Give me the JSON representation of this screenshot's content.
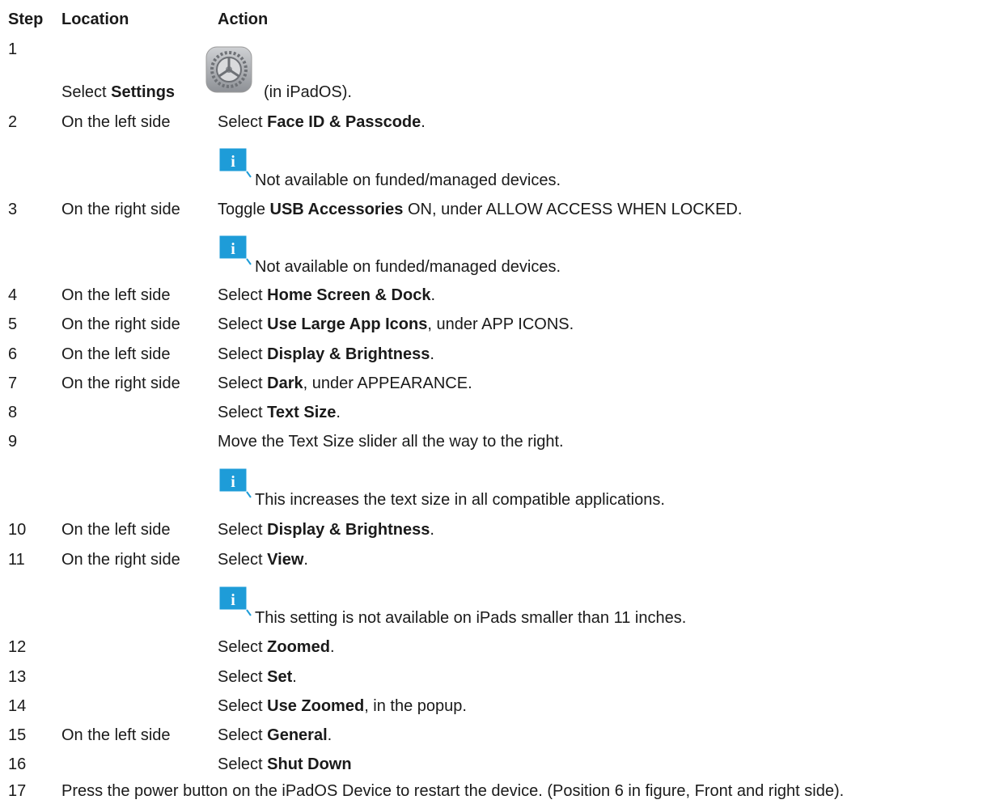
{
  "header": {
    "step": "Step",
    "location": "Location",
    "action": "Action"
  },
  "row1": {
    "step": "1",
    "prefix": "Select ",
    "bold": "Settings",
    "suffix": " (in iPadOS).",
    "icon": "settings-gear-icon"
  },
  "rows": [
    {
      "step": "2",
      "location": "On the left side",
      "pre": "Select ",
      "bold": "Face ID & Passcode",
      "post": "."
    },
    {
      "step": "3",
      "location": "On the right side",
      "pre": "Toggle ",
      "bold": "USB Accessories",
      "post": " ON, under ALLOW ACCESS WHEN LOCKED."
    },
    {
      "step": "4",
      "location": "On the left side",
      "pre": "Select ",
      "bold": "Home Screen & Dock",
      "post": "."
    },
    {
      "step": "5",
      "location": "On the right side",
      "pre": "Select ",
      "bold": "Use Large App Icons",
      "post": ", under APP ICONS."
    },
    {
      "step": "6",
      "location": "On the left side",
      "pre": "Select ",
      "bold": "Display & Brightness",
      "post": "."
    },
    {
      "step": "7",
      "location": "On the right side",
      "pre": "Select ",
      "bold": "Dark",
      "post": ", under APPEARANCE."
    },
    {
      "step": "8",
      "location": "",
      "pre": "Select ",
      "bold": "Text Size",
      "post": "."
    },
    {
      "step": "9",
      "location": "",
      "pre": "Move the Text Size slider all the way to the right.",
      "bold": "",
      "post": ""
    },
    {
      "step": "10",
      "location": "On the left side",
      "pre": "Select ",
      "bold": "Display & Brightness",
      "post": "."
    },
    {
      "step": "11",
      "location": "On the right side",
      "pre": "Select ",
      "bold": "View",
      "post": "."
    },
    {
      "step": "12",
      "location": "",
      "pre": "Select ",
      "bold": "Zoomed",
      "post": "."
    },
    {
      "step": "13",
      "location": "",
      "pre": "Select ",
      "bold": "Set",
      "post": "."
    },
    {
      "step": "14",
      "location": "",
      "pre": "Select ",
      "bold": "Use Zoomed",
      "post": ", in the popup."
    },
    {
      "step": "15",
      "location": "On the left side",
      "pre": "Select ",
      "bold": "General",
      "post": "."
    },
    {
      "step": "16",
      "location": "",
      "pre": "Select ",
      "bold": "Shut Down",
      "post": ""
    }
  ],
  "notes": [
    "Not available on funded/managed devices.",
    "Not available on funded/managed devices.",
    "This increases the text size in all compatible applications.",
    "This setting is not available on iPads smaller than 11 inches."
  ],
  "row17": {
    "step": "17",
    "text": "Press the power button on the iPadOS Device to restart the device. (Position 6 in figure, Front and right side)."
  },
  "colors": {
    "info_blue": "#1e9cd8",
    "text": "#1a1a1a"
  }
}
